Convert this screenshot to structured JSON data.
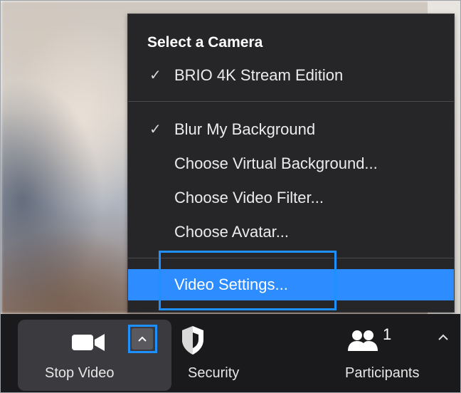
{
  "menu": {
    "heading": "Select a Camera",
    "camera_item": {
      "check": "✓",
      "label": "BRIO 4K Stream Edition"
    },
    "blur_item": {
      "check": "✓",
      "label": "Blur My Background"
    },
    "virtual_bg_label": "Choose Virtual Background...",
    "video_filter_label": "Choose Video Filter...",
    "avatar_label": "Choose Avatar...",
    "video_settings_label": "Video Settings..."
  },
  "toolbar": {
    "stop_video_label": "Stop Video",
    "caret": "^",
    "security_label": "Security",
    "participants_label": "Participants",
    "participants_count": "1",
    "more_caret": "^"
  },
  "icons": {
    "camera": "video-camera-icon",
    "caret": "chevron-up-icon",
    "security": "shield-icon",
    "participants": "people-icon"
  },
  "colors": {
    "menu_bg": "#262629",
    "highlight": "#2d8cff",
    "annotation": "#1e90ff",
    "toolbar_bg": "#1a1a1c"
  }
}
